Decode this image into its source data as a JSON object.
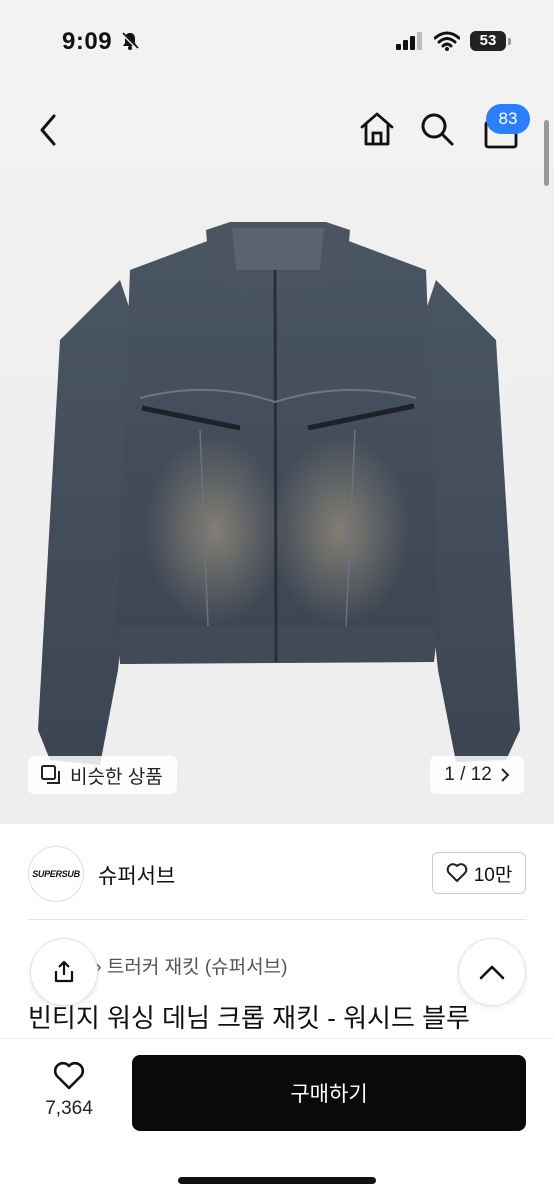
{
  "status_bar": {
    "time": "9:09",
    "battery": "53"
  },
  "header": {
    "cart_badge": "83"
  },
  "gallery": {
    "similar_label": "비슷한 상품",
    "pager": "1 / 12"
  },
  "brand": {
    "logo_text": "SUPERSUB",
    "name": "슈퍼서브",
    "likes": "10만"
  },
  "product": {
    "breadcrumb": "트러커 재킷 (슈퍼서브)",
    "title": "빈티지 워싱 데님 크롭 재킷 - 워시드 블루"
  },
  "bottom": {
    "wish_count": "7,364",
    "buy_label": "구매하기"
  }
}
